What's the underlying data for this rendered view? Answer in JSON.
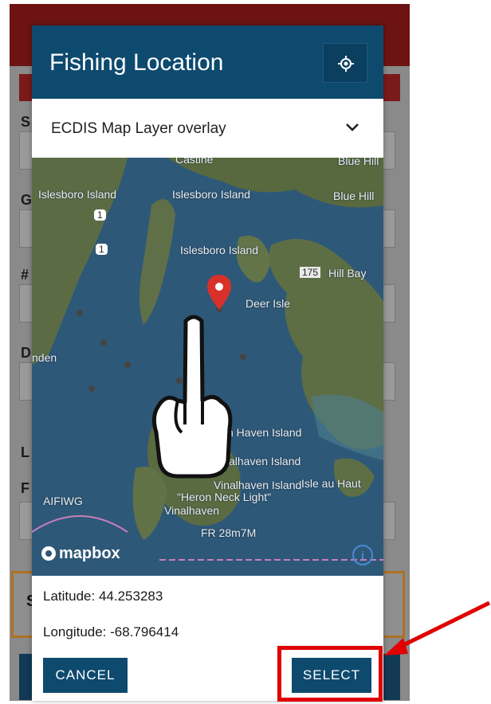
{
  "modal": {
    "title": "Fishing Location",
    "locate_icon": "crosshair-icon",
    "layer_select": {
      "value": "ECDIS Map Layer overlay",
      "icon": "chevron-down-icon"
    }
  },
  "map": {
    "labels": [
      "Castine",
      "Islesboro Island",
      "Islesboro Island",
      "Blue Hill",
      "Blue Hill",
      "Islesboro Island",
      "175",
      "Deer Isle",
      "Hill Bay",
      "nden",
      "n Haven Island",
      "alhaven Island",
      "Vinalhaven Island",
      "Isle au Haut",
      "AIFIWG",
      "Vinalhaven",
      "\"Heron Neck Light\"",
      "FR 28m7M",
      "1",
      "1"
    ],
    "attribution": "mapbox",
    "info_label": "i"
  },
  "location": {
    "latitude": "Latitude: 44.253283",
    "longitude": "Longitude: -68.796414"
  },
  "actions": {
    "cancel_label": "CANCEL",
    "select_label": "SELECT"
  },
  "background": {
    "labels": [
      "S",
      "G",
      "#",
      "D",
      "L",
      "F",
      "S"
    ]
  },
  "colors": {
    "header": "#0e4a6e",
    "button": "#0e4a6e",
    "highlight": "#e00000",
    "pin": "#d9302a"
  }
}
